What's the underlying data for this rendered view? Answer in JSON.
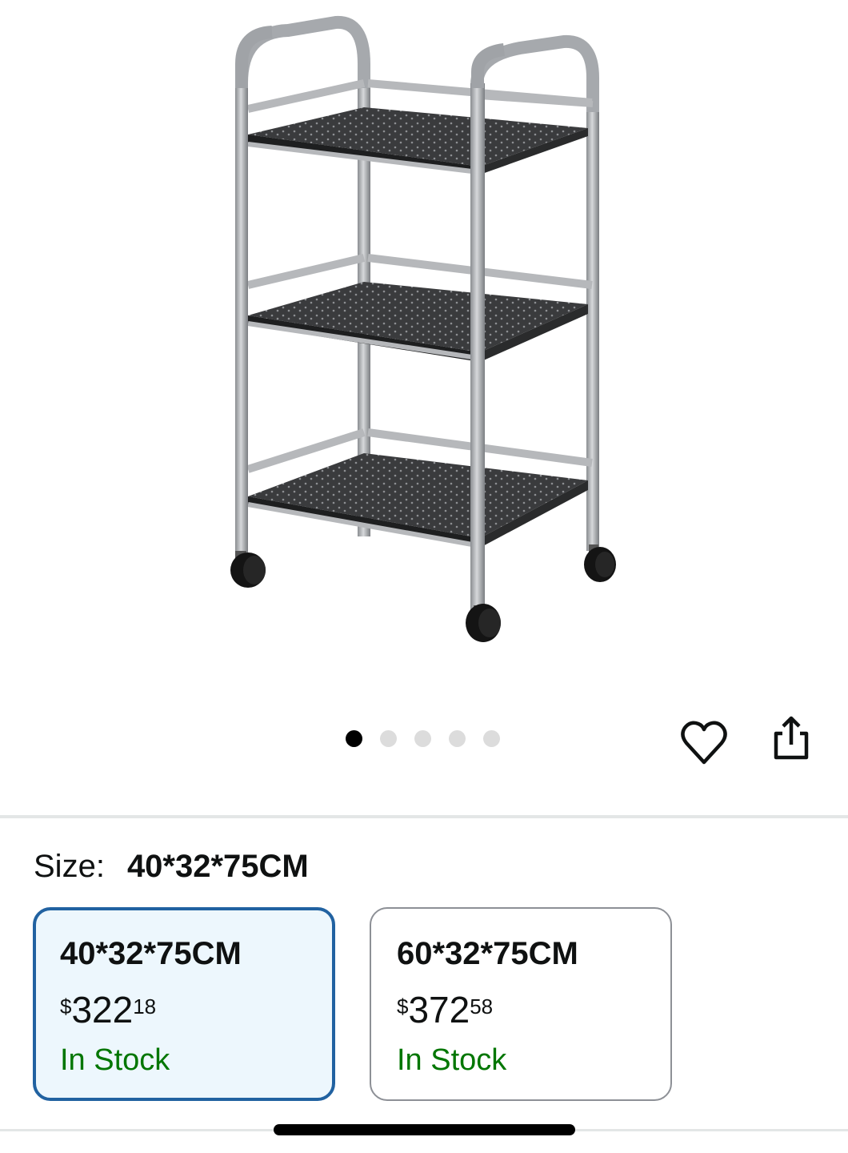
{
  "product_image": {
    "icon": "rolling-three-tier-cart-image"
  },
  "carousel": {
    "dot_count": 5,
    "active_index": 0
  },
  "actions": {
    "favorite_icon": "heart-icon",
    "share_icon": "share-icon"
  },
  "size": {
    "label": "Size:",
    "selected_value": "40*32*75CM",
    "options": [
      {
        "name": "40*32*75CM",
        "currency": "$",
        "price_whole": "322",
        "price_fraction": "18",
        "availability": "In Stock",
        "selected": true
      },
      {
        "name": "60*32*75CM",
        "currency": "$",
        "price_whole": "372",
        "price_fraction": "58",
        "availability": "In Stock",
        "selected": false
      }
    ]
  },
  "colors": {
    "selected_border": "#2162a1",
    "selected_bg": "#edf7fd",
    "in_stock": "#007600",
    "divider": "#e3e6e6"
  }
}
